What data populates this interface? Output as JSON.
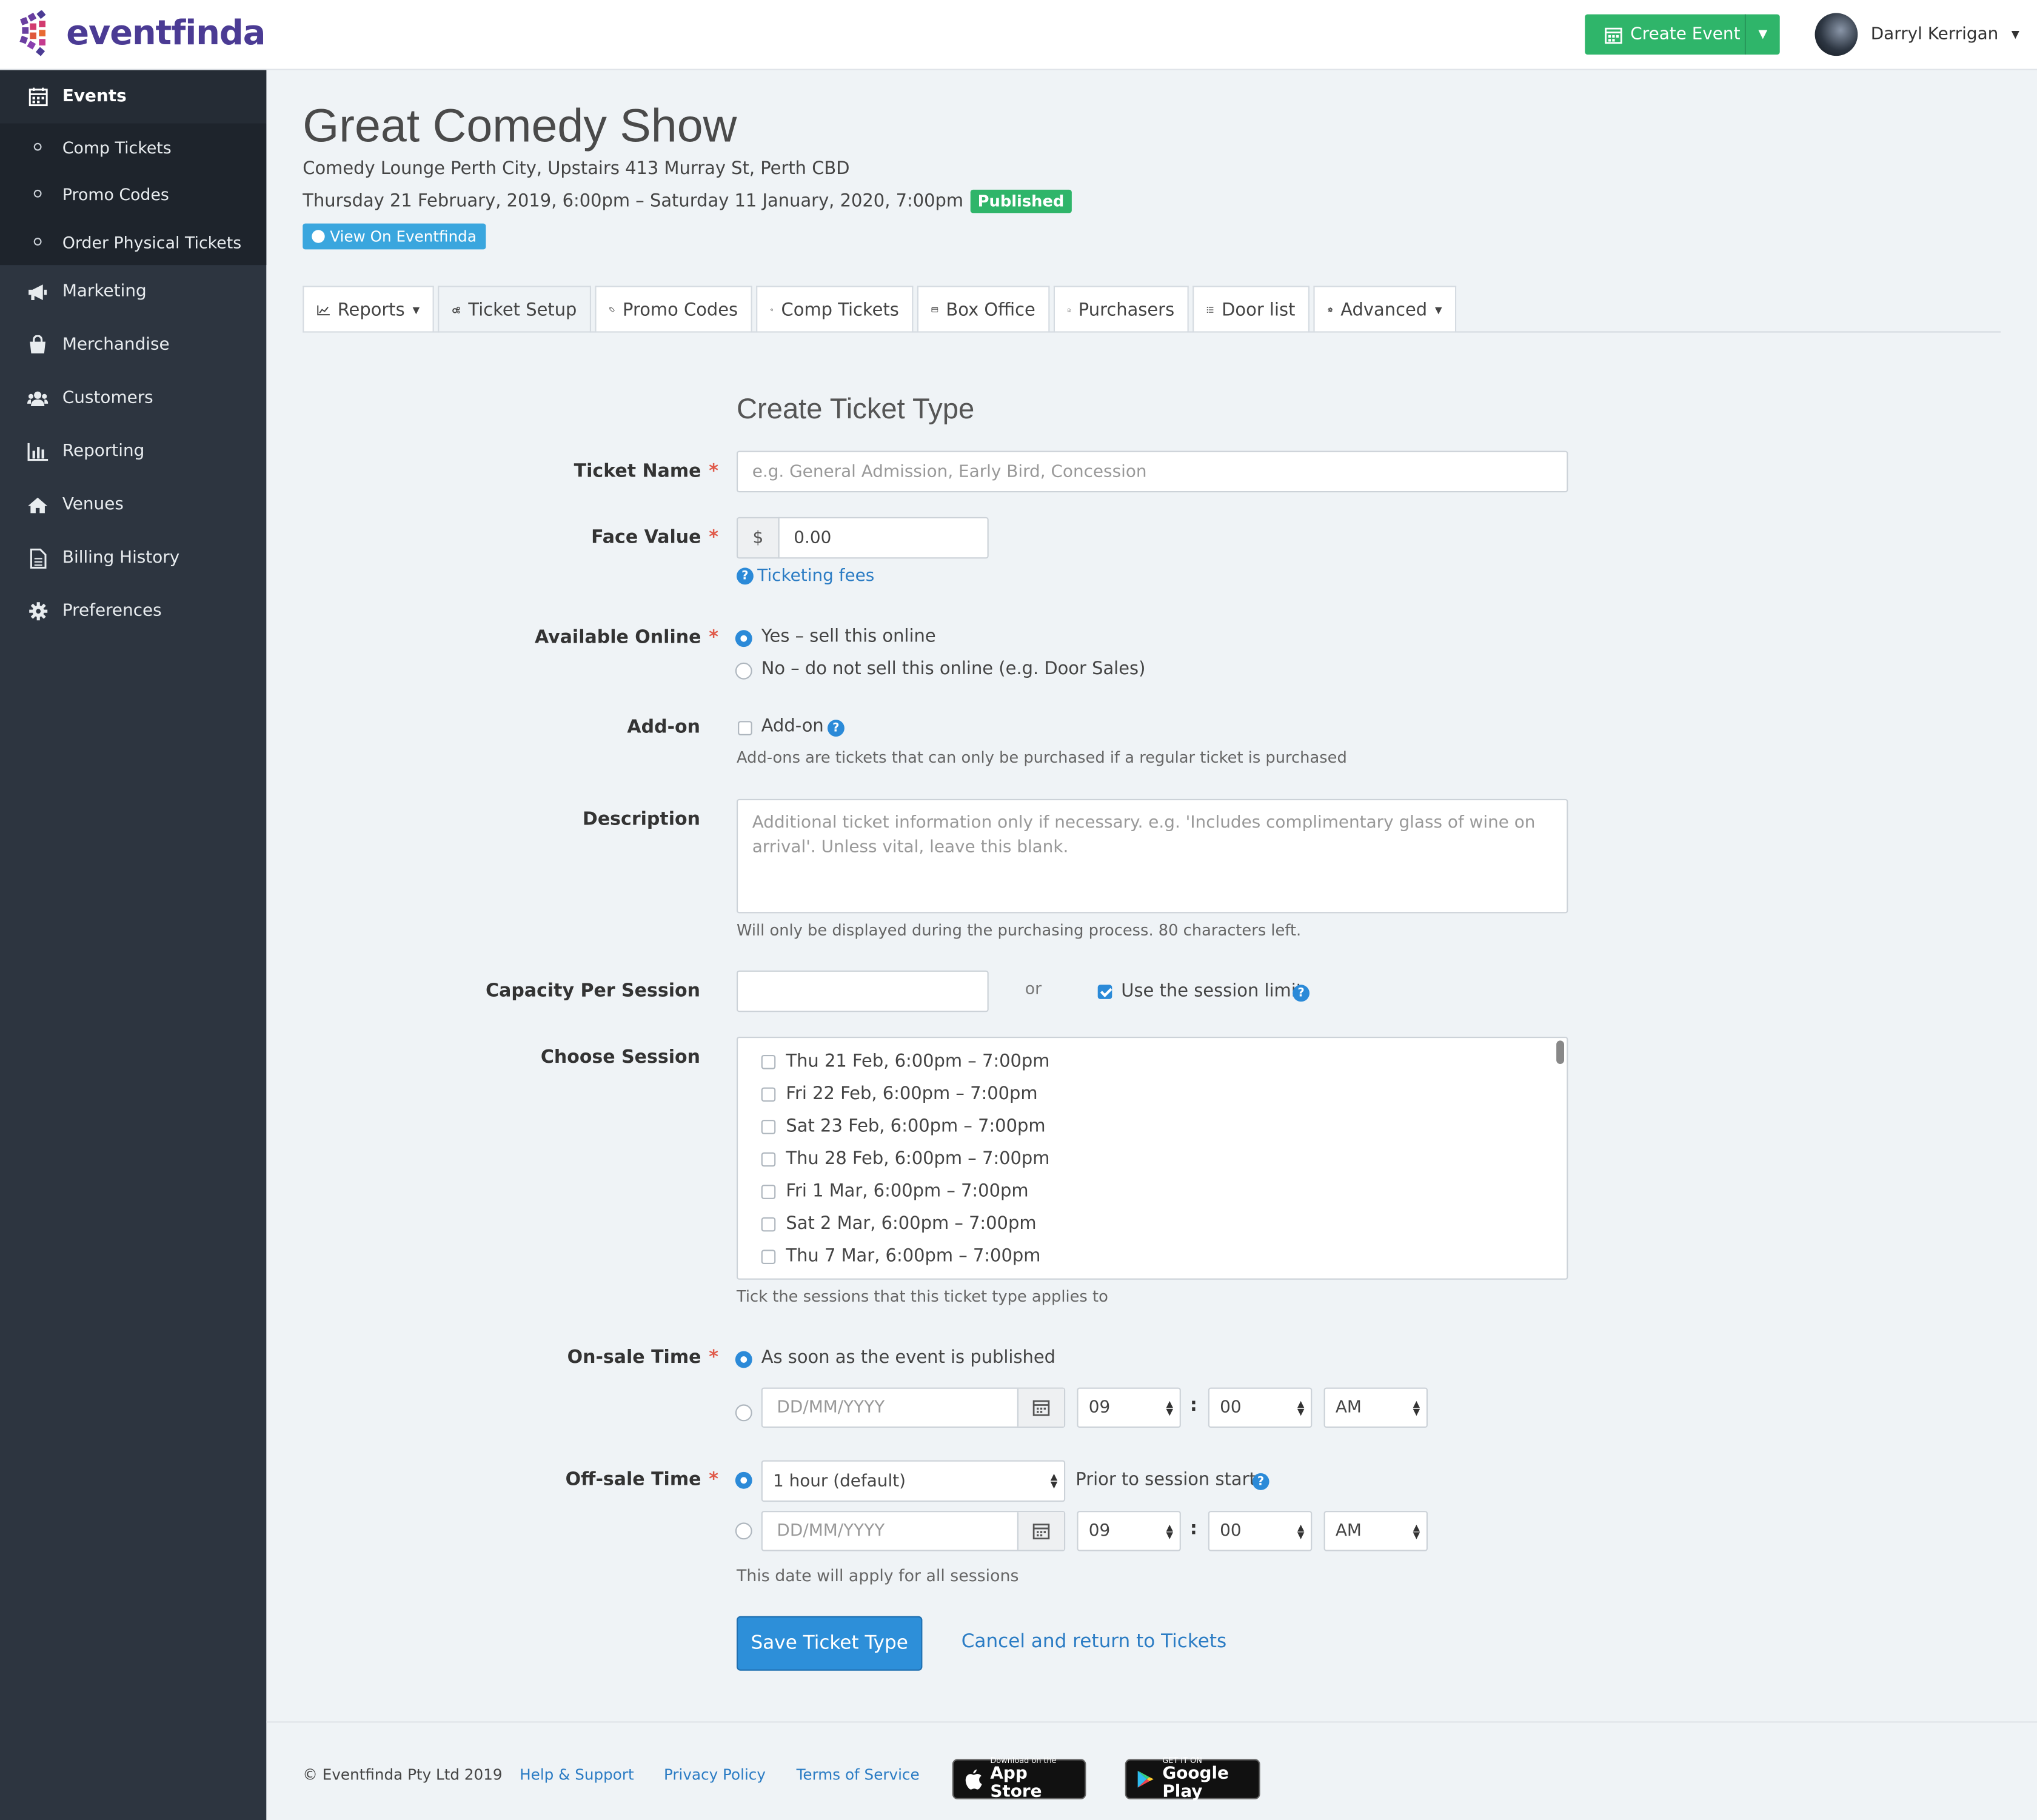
{
  "brand": {
    "name": "eventfinda",
    "color": "#4b3b94"
  },
  "topbar": {
    "create_event": "Create Event",
    "user_name": "Darryl Kerrigan"
  },
  "sidebar": {
    "items": [
      {
        "label": "Events",
        "icon": "calendar-icon",
        "active": true
      },
      {
        "label": "Marketing",
        "icon": "megaphone-icon"
      },
      {
        "label": "Merchandise",
        "icon": "shopping-bag-icon"
      },
      {
        "label": "Customers",
        "icon": "users-icon"
      },
      {
        "label": "Reporting",
        "icon": "bar-chart-icon"
      },
      {
        "label": "Venues",
        "icon": "home-icon"
      },
      {
        "label": "Billing History",
        "icon": "document-icon"
      },
      {
        "label": "Preferences",
        "icon": "gear-icon"
      }
    ],
    "sub_items": [
      "Comp Tickets",
      "Promo Codes",
      "Order Physical Tickets"
    ]
  },
  "event": {
    "title": "Great Comedy Show",
    "venue": "Comedy Lounge Perth City, Upstairs 413 Murray St, Perth CBD",
    "dates": "Thursday 21 February, 2019, 6:00pm – Saturday 11 January, 2020, 7:00pm",
    "status": "Published",
    "view_link": "View On Eventfinda"
  },
  "tabs": [
    "Reports",
    "Ticket Setup",
    "Promo Codes",
    "Comp Tickets",
    "Box Office",
    "Purchasers",
    "Door list",
    "Advanced"
  ],
  "form": {
    "title": "Create Ticket Type",
    "ticket_name": {
      "label": "Ticket Name",
      "placeholder": "e.g. General Admission, Early Bird, Concession"
    },
    "face_value": {
      "label": "Face Value",
      "currency": "$",
      "value": "0.00",
      "fees_link": "Ticketing fees"
    },
    "available_online": {
      "label": "Available Online",
      "yes": "Yes – sell this online",
      "no": "No – do not sell this online (e.g. Door Sales)"
    },
    "addon": {
      "label": "Add-on",
      "checkbox": "Add-on",
      "help": "Add-ons are tickets that can only be purchased if a regular ticket is purchased"
    },
    "description": {
      "label": "Description",
      "placeholder": "Additional ticket information only if necessary. e.g. 'Includes complimentary glass of wine on arrival'. Unless vital, leave this blank.",
      "help": "Will only be displayed during the purchasing process. 80 characters left."
    },
    "capacity": {
      "label": "Capacity Per Session",
      "or": "or",
      "session_limit": "Use the session limit"
    },
    "sessions": {
      "label": "Choose Session",
      "items": [
        "Thu 21 Feb, 6:00pm – 7:00pm",
        "Fri 22 Feb, 6:00pm – 7:00pm",
        "Sat 23 Feb, 6:00pm – 7:00pm",
        "Thu 28 Feb, 6:00pm – 7:00pm",
        "Fri 1 Mar, 6:00pm – 7:00pm",
        "Sat 2 Mar, 6:00pm – 7:00pm",
        "Thu 7 Mar, 6:00pm – 7:00pm"
      ],
      "help": "Tick the sessions that this ticket type applies to"
    },
    "onsale": {
      "label": "On-sale Time",
      "option": "As soon as the event is published",
      "date_placeholder": "DD/MM/YYYY",
      "hour": "09",
      "minute": "00",
      "ampm": "AM"
    },
    "offsale": {
      "label": "Off-sale Time",
      "select": "1 hour (default)",
      "prior": "Prior to session start",
      "date_placeholder": "DD/MM/YYYY",
      "hour": "09",
      "minute": "00",
      "ampm": "AM",
      "help": "This date will apply for all sessions"
    },
    "save": "Save Ticket Type",
    "cancel": "Cancel and return to Tickets"
  },
  "footer": {
    "copyright": "© Eventfinda Pty Ltd 2019",
    "links": [
      "Help & Support",
      "Privacy Policy",
      "Terms of Service"
    ],
    "appstore": {
      "small": "Download on the",
      "big": "App Store"
    },
    "googleplay": {
      "small": "GET IT ON",
      "big": "Google Play"
    }
  }
}
